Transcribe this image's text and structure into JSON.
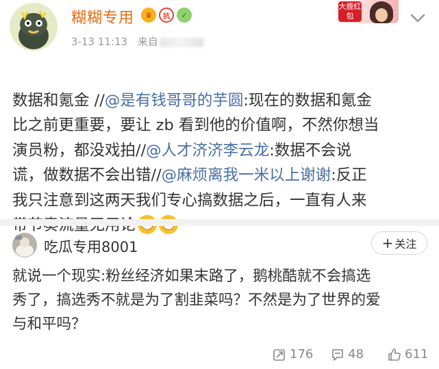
{
  "post": {
    "author": "糊糊专用",
    "time": "3-13 11:13",
    "source_prefix": "来自",
    "promo_label": "大鹿红包",
    "text_segments": [
      {
        "text": "数据和氪金 //",
        "mention": false
      },
      {
        "text": "@是有钱哥哥的芋圆",
        "mention": true
      },
      {
        "text": ":现在的数据和氪金\n比之前更重要，要让 zb 看到他的价值啊，不然你想当\n演员粉，都没戏拍//",
        "mention": false
      },
      {
        "text": "@人才济济李云龙",
        "mention": true
      },
      {
        "text": ":数据不会说\n谎，做数据不会出错//",
        "mention": false
      },
      {
        "text": "@麻烦离我一米以上谢谢",
        "mention": true
      },
      {
        "text": ":反正\n我只注意到这两天我们专心搞数据之后，一直有人来\n带节奏流量无用论",
        "mention": false
      }
    ],
    "emoji": [
      "grin-emoji",
      "grin-emoji"
    ]
  },
  "comment": {
    "author": "吃瓜专用8001",
    "follow_label": "关注",
    "text": "就说一个现实:粉丝经济如果末路了，鹅桃酷就不会搞选\n秀了，搞选秀不就是为了割韭菜吗？不然是为了世界的爱\n与和平吗？"
  },
  "actions": {
    "repost_count": "176",
    "comment_count": "48",
    "like_count": "611"
  },
  "colors": {
    "username": "#e86b10",
    "mention": "#4a6fa5",
    "text": "#333333",
    "meta": "#999999"
  },
  "icons": {
    "badges": [
      "crown-badge-icon",
      "fan-badge-icon",
      "verified-badge-icon"
    ],
    "repost": "repost-icon",
    "comment": "comment-icon",
    "like": "thumbs-up-icon",
    "menu": "chevron-down-icon"
  }
}
